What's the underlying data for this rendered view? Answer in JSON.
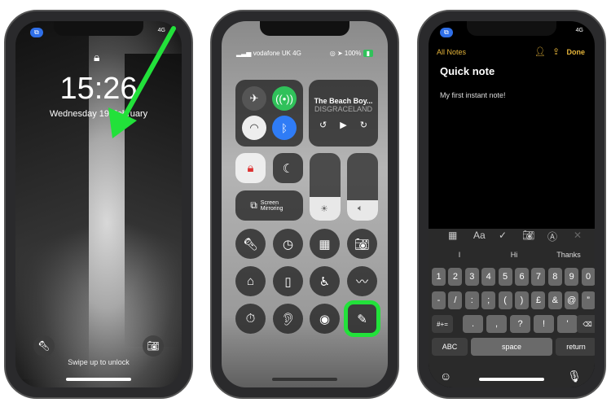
{
  "colors": {
    "accent_green": "#22e13a",
    "notes_yellow": "#e6b53a",
    "ios_blue": "#2f6fe8",
    "toggle_green": "#30c15a"
  },
  "lock": {
    "time": "15:26",
    "date": "Wednesday 19 February",
    "swipe_text": "Swipe up to unlock",
    "status": "4G"
  },
  "control": {
    "carrier": "vodafone UK 4G",
    "battery": "100%",
    "music_title": "The Beach Boy...",
    "music_artist": "DISGRACELAND",
    "screen_mirroring": "Screen Mirroring",
    "brightness_level": 0.35,
    "volume_level": 0.3
  },
  "notes": {
    "status": "4G",
    "back": "All Notes",
    "done": "Done",
    "title": "Quick note",
    "body": "My first instant note!",
    "suggestions": [
      "I",
      "Hi",
      "Thanks"
    ],
    "rows": [
      [
        "1",
        "2",
        "3",
        "4",
        "5",
        "6",
        "7",
        "8",
        "9",
        "0"
      ],
      [
        "-",
        "/",
        ":",
        ";",
        "(",
        ")",
        "£",
        "&",
        "@",
        "”"
      ]
    ],
    "row3": {
      "shift": "#+=",
      "keys": [
        ".",
        ",",
        "?",
        "!",
        "'"
      ],
      "delete": "⌫"
    },
    "abc": "ABC",
    "space": "space",
    "return": "return"
  }
}
